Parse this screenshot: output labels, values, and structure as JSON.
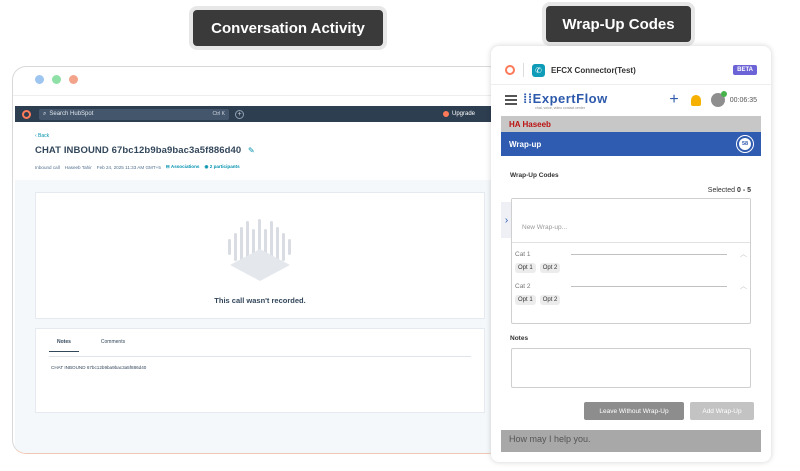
{
  "callouts": {
    "conversation": "Conversation Activity",
    "wrapup": "Wrap-Up Codes"
  },
  "hubspot": {
    "search_placeholder": "Search HubSpot",
    "search_shortcut": "Ctrl K",
    "upgrade_label": "Upgrade",
    "back_label": "‹ Back",
    "record_title": "CHAT INBOUND 67bc12b9ba9bac3a5f886d40",
    "meta": {
      "type": "Inbound call",
      "owner": "Haseeb Tahir",
      "datetime": "Feb 24, 2025 11:33 AM GMT+5",
      "associations": "Associations",
      "participants": "2 participants"
    },
    "no_recording": "This call wasn't recorded.",
    "tabs": [
      "Notes",
      "Comments"
    ],
    "note_text": "CHAT INBOUND 67bc12b9ba9bac3a5f886d40"
  },
  "panel": {
    "app_name": "EFCX Connector(Test)",
    "beta": "BETA",
    "logo_name": "ExpertFlow",
    "logo_tagline": "chat, voice, video contact center",
    "timer": "00:06:35",
    "bg_customer": "HA   Haseeb",
    "bg_message": "How may I help you.",
    "modal": {
      "title": "Wrap-up",
      "countdown": "58",
      "codes_label": "Wrap-Up Codes",
      "selected_prefix": "Selected ",
      "selected_value": "0 - 5",
      "new_placeholder": "New Wrap-up...",
      "categories": [
        {
          "name": "Cat 1",
          "options": [
            "Opt 1",
            "Opt 2"
          ]
        },
        {
          "name": "Cat 2",
          "options": [
            "Opt 1",
            "Opt 2"
          ]
        }
      ],
      "notes_label": "Notes",
      "leave_button": "Leave Without Wrap-Up",
      "add_button": "Add Wrap-Up"
    }
  }
}
